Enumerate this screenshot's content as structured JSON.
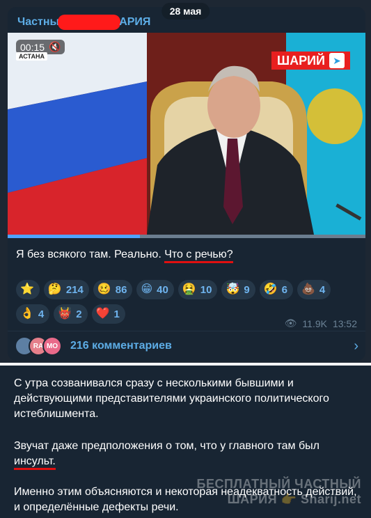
{
  "date_label": "28 мая",
  "post": {
    "channel_name_left": "Частны",
    "channel_name_right": "АРИЯ",
    "video": {
      "time": "00:15",
      "location": "АСТАНА",
      "logo": "ШАРИЙ",
      "progress": 0.37
    },
    "caption_plain": "Я без всякого там. Реально.",
    "caption_highlight": "Что с речью?",
    "reactions": [
      {
        "emoji": "⭐",
        "count": "",
        "icon": "star-icon"
      },
      {
        "emoji": "🤔",
        "count": "214",
        "icon": "thinking-icon"
      },
      {
        "emoji": "🥴",
        "count": "86",
        "icon": "woozy-icon"
      },
      {
        "emoji": "😁",
        "count": "40",
        "icon": "grin-icon"
      },
      {
        "emoji": "🤮",
        "count": "10",
        "icon": "vomit-icon"
      },
      {
        "emoji": "🤯",
        "count": "9",
        "icon": "mind-blown-icon"
      },
      {
        "emoji": "🤣",
        "count": "6",
        "icon": "rofl-icon"
      },
      {
        "emoji": "💩",
        "count": "4",
        "icon": "poop-icon"
      },
      {
        "emoji": "👌",
        "count": "4",
        "icon": "ok-hand-icon"
      },
      {
        "emoji": "👹",
        "count": "2",
        "icon": "ogre-icon"
      },
      {
        "emoji": "❤️",
        "count": "1",
        "icon": "heart-icon"
      }
    ],
    "views": "11.9K",
    "time": "13:52",
    "comments": {
      "label": "216 комментариев",
      "avatars": [
        "",
        "RA",
        "MO"
      ]
    }
  },
  "post2": {
    "para1": "С утра созванивался сразу с несколькими бывшими и действующими представителями украинского политического истеблишмента.",
    "para2_plain": "Звучат даже предположения о том, что у главного там был",
    "para2_highlight": "инсульт.",
    "para3": "Именно этим объясняются и некоторая неадекватность действий, и определённые дефекты речи."
  },
  "watermark": {
    "line1": "БЕСПЛАТНЫЙ ЧАСТНЫЙ",
    "line2": "ШАРИЯ 👉 Sharij.net"
  },
  "colors": {
    "background": "#1d2733",
    "bubble": "#182533",
    "accent": "#5dade6",
    "reaction_bg": "#263849",
    "underline": "#e01010"
  }
}
